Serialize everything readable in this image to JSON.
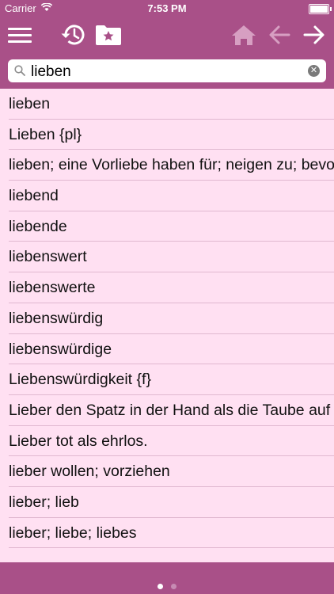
{
  "status": {
    "carrier": "Carrier",
    "time": "7:53 PM"
  },
  "icons": {
    "menu": "hamburger-menu-icon",
    "history": "history-clock-icon",
    "folder": "favorites-folder-star-icon",
    "home": "home-icon",
    "back": "back-arrow-icon",
    "forward": "forward-arrow-icon"
  },
  "search": {
    "value": "lieben",
    "placeholder": ""
  },
  "results": [
    "lieben",
    "Lieben {pl}",
    "lieben; eine Vorliebe haben für; neigen zu; bevorzugen",
    "liebend",
    "liebende",
    "liebenswert",
    "liebenswerte",
    "liebenswürdig",
    "liebenswürdige",
    "Liebenswürdigkeit {f}",
    "Lieber den Spatz in der Hand als die Taube auf dem Dach.",
    "Lieber tot als ehrlos.",
    "lieber wollen; vorziehen",
    "lieber; lieb",
    "lieber; liebe; liebes"
  ],
  "colors": {
    "bar": "#a95088",
    "list_bg": "#ffe0f2"
  },
  "pager": {
    "pages": 2,
    "current": 1
  }
}
